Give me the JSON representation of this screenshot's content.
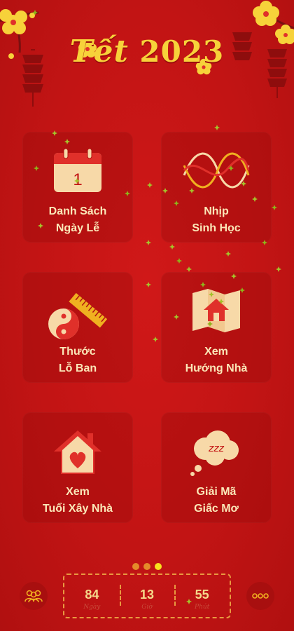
{
  "app": {
    "title_prefix": "Tết",
    "title_year": "2023"
  },
  "menu": [
    {
      "line1": "Danh Sách",
      "line2": "Ngày Lễ",
      "icon": "calendar-icon",
      "calendar_day": "1"
    },
    {
      "line1": "Nhịp",
      "line2": "Sinh Học",
      "icon": "biorhythm-wave-icon"
    },
    {
      "line1": "Thước",
      "line2": "Lỗ Ban",
      "icon": "yin-yang-ruler-icon"
    },
    {
      "line1": "Xem",
      "line2": "Hướng Nhà",
      "icon": "house-map-icon"
    },
    {
      "line1": "Xem",
      "line2": "Tuổi Xây Nhà",
      "icon": "heart-house-icon"
    },
    {
      "line1": "Giải Mã",
      "line2": "Giấc Mơ",
      "icon": "dream-cloud-icon",
      "dream_text": "zzz"
    }
  ],
  "pager": {
    "count": 3,
    "active_index": 2
  },
  "countdown": [
    {
      "value": "84",
      "unit": "Ngày"
    },
    {
      "value": "13",
      "unit": "Giờ"
    },
    {
      "value": "55",
      "unit": "Phút"
    }
  ],
  "colors": {
    "background": "#c21414",
    "accent_yellow": "#f7d23a",
    "label": "#fbe7b8",
    "dash": "#e89a40"
  }
}
